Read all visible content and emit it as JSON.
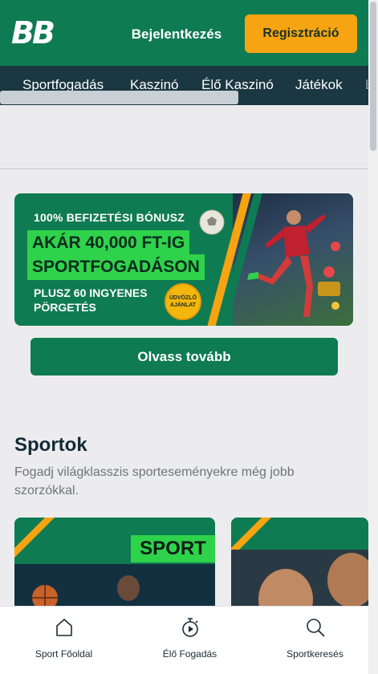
{
  "header": {
    "logo_text": "BB",
    "login_label": "Bejelentkezés",
    "register_label": "Regisztráció"
  },
  "nav": {
    "items": [
      "Sportfogadás",
      "Kaszinó",
      "Élő Kaszinó",
      "Játékok",
      "E"
    ]
  },
  "banner": {
    "line1": "100% BEFIZETÉSI BÓNUSZ",
    "headline1": "AKÁR 40,000 FT-IG",
    "headline2": "SPORTFOGADÁSON",
    "line3": "PLUSZ 60 INGYENES PÖRGETÉS",
    "badge_line1": "ÜDVÖZLŐ",
    "badge_line2": "AJÁNLAT"
  },
  "read_more_label": "Olvass tovább",
  "sports_section": {
    "title": "Sportok",
    "description": "Fogadj világklasszis sporteseményekre még jobb szorzókkal.",
    "card1_label": "SPORT"
  },
  "bottom_nav": {
    "items": [
      {
        "label": "Sport Főoldal",
        "icon": "home-icon"
      },
      {
        "label": "Élő Fogadás",
        "icon": "stopwatch-icon"
      },
      {
        "label": "Sportkeresés",
        "icon": "search-icon"
      }
    ]
  },
  "colors": {
    "brand_green": "#0f7b52",
    "accent_orange": "#f7a412",
    "nav_dark": "#1b3742",
    "highlight_green": "#2fd24b"
  }
}
